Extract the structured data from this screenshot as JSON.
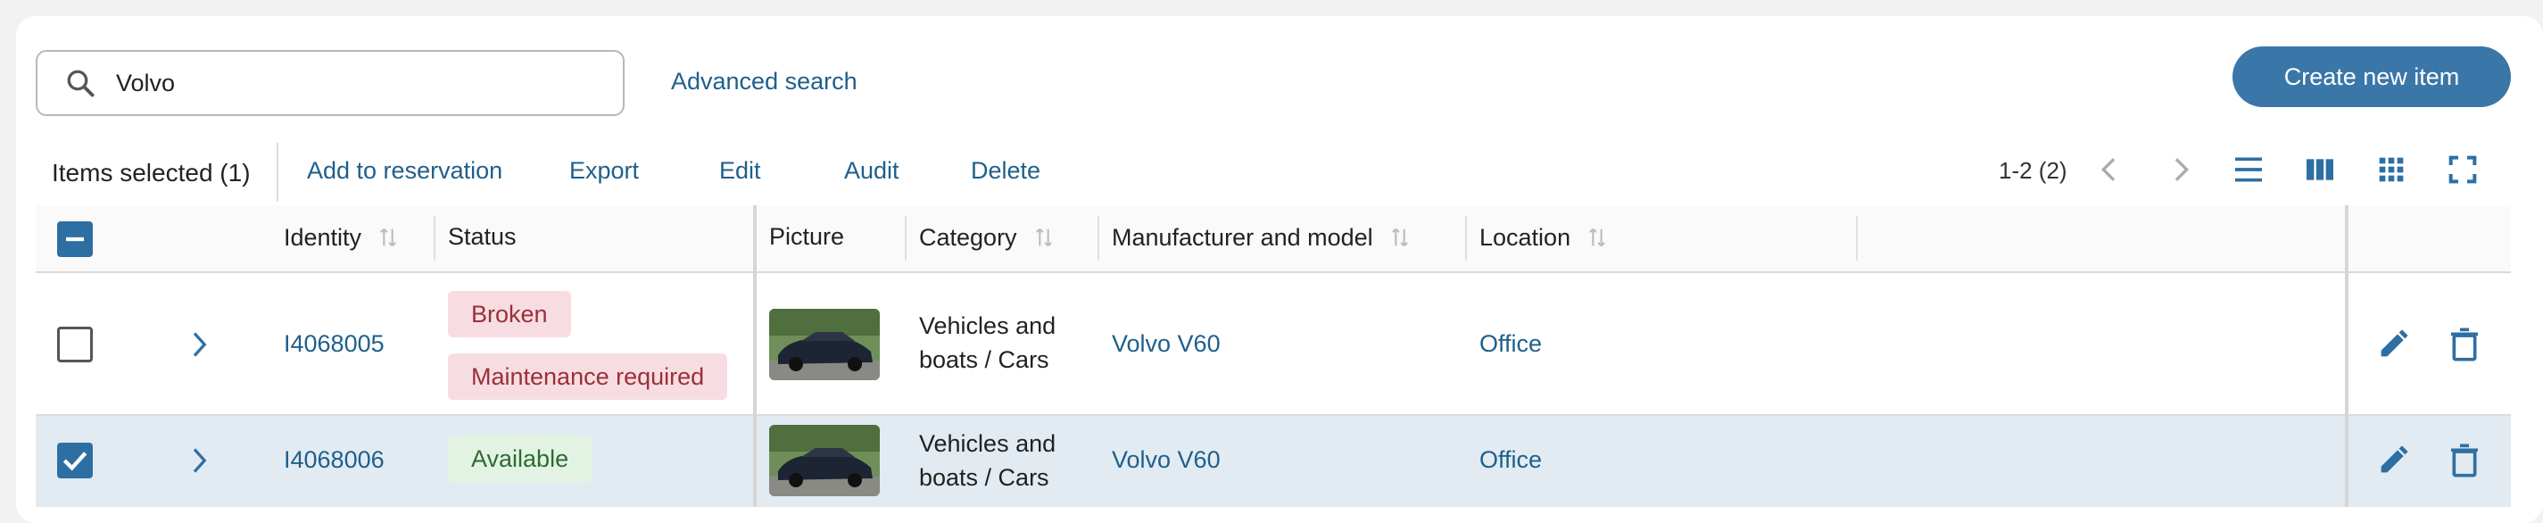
{
  "search": {
    "value": "Volvo"
  },
  "advanced_search_label": "Advanced search",
  "create_button_label": "Create new item",
  "toolbar": {
    "selected_label": "Items selected (1)",
    "actions": [
      "Add to reservation",
      "Export",
      "Edit",
      "Audit",
      "Delete"
    ],
    "pagination": "1-2 (2)"
  },
  "columns": [
    "Identity",
    "Status",
    "Picture",
    "Category",
    "Manufacturer and model",
    "Location"
  ],
  "rows": [
    {
      "identity": "I4068005",
      "status": [
        "Broken",
        "Maintenance required"
      ],
      "category_line1": "Vehicles and",
      "category_line2": "boats / Cars",
      "model": "Volvo V60",
      "location": "Office",
      "checked": false
    },
    {
      "identity": "I4068006",
      "status": [
        "Available"
      ],
      "category_line1": "Vehicles and",
      "category_line2": "boats / Cars",
      "model": "Volvo V60",
      "location": "Office",
      "checked": true
    }
  ],
  "colors": {
    "accent": "#3a76a8",
    "link": "#1f5f8b",
    "selected_row": "#e2ebf2",
    "badge_red_bg": "#f7dde1",
    "badge_green_bg": "#e3f3e3"
  }
}
